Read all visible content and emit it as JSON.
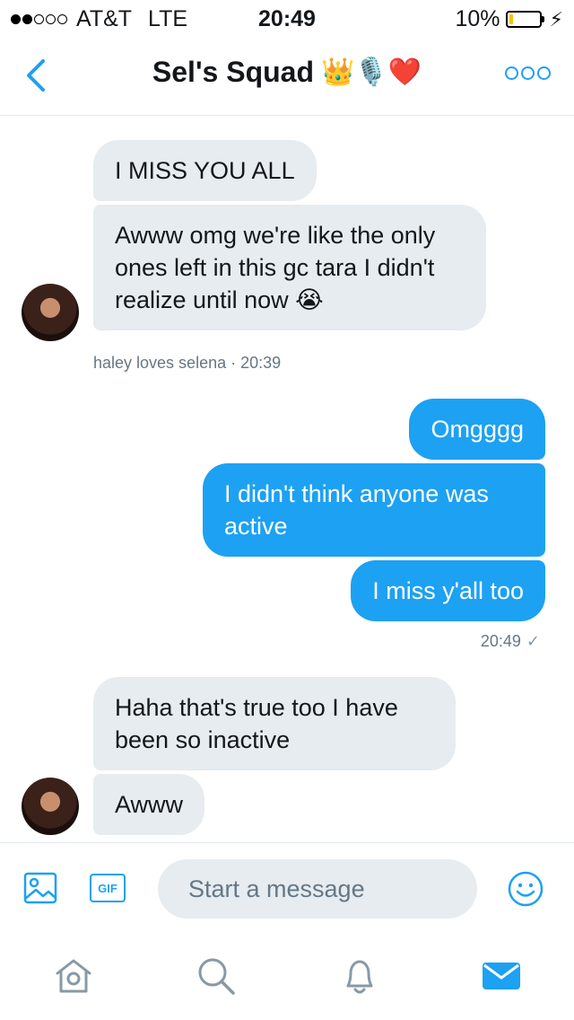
{
  "status_bar": {
    "signal_filled": 2,
    "signal_total": 5,
    "carrier": "AT&T",
    "network": "LTE",
    "time": "20:49",
    "battery_text": "10%",
    "battery_level": 0.1,
    "charging_icon": "bolt-icon"
  },
  "header": {
    "title": "Sel's Squad",
    "title_emojis": "👑🎙️❤️",
    "back_icon": "chevron-left-icon",
    "more_icon": "more-options-icon"
  },
  "messages": {
    "group1": [
      "I MISS YOU ALL",
      "Awww omg we're like the only ones left in this gc tara I didn't realize until now 😭"
    ],
    "group1_meta": "haley loves selena · 20:39",
    "group2": [
      "Omgggg",
      "I didn't think anyone was active",
      "I miss y'all too"
    ],
    "group2_meta": "20:49",
    "group2_check": "✓",
    "group3": [
      "Haha that's true too I have been so inactive",
      "Awww"
    ]
  },
  "composer": {
    "placeholder": "Start a message",
    "gif_label": "GIF",
    "image_icon": "image-icon",
    "emoji_icon": "emoji-icon"
  },
  "tabs": [
    {
      "name": "home",
      "icon": "home-icon"
    },
    {
      "name": "search",
      "icon": "search-icon"
    },
    {
      "name": "notifications",
      "icon": "bell-icon"
    },
    {
      "name": "messages",
      "icon": "mail-icon"
    }
  ],
  "colors": {
    "accent": "#1da1f2",
    "incoming_bubble": "#e6ecf0",
    "battery": "#f5c400",
    "tab_inactive": "#8899a6"
  }
}
